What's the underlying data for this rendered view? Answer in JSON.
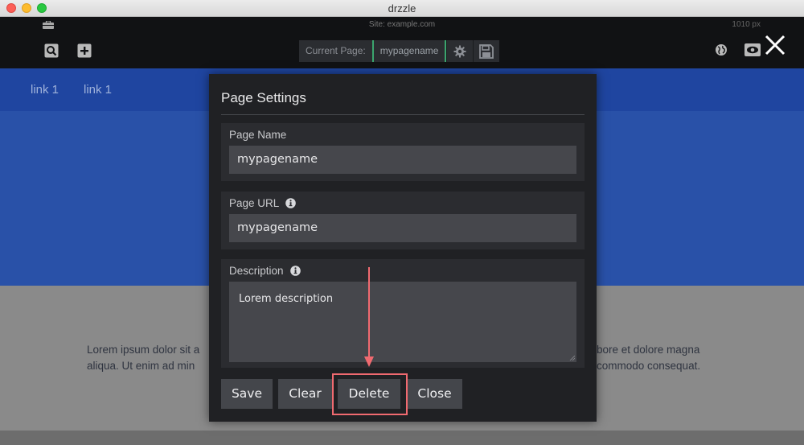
{
  "window": {
    "title": "drzzle"
  },
  "topbar": {
    "site_label": "Site: example.com",
    "width_label": "1010 px",
    "current_page_label": "Current Page:",
    "current_page_name": "mypagename",
    "icons": [
      "briefcase-icon",
      "preview-page-icon",
      "add-page-icon",
      "settings-icon",
      "save-icon",
      "globe-icon",
      "eye-icon",
      "close-icon"
    ]
  },
  "preview": {
    "nav_links": [
      "link 1",
      "link 1"
    ],
    "lorem_left_1": "Lorem ipsum dolor sit a",
    "lorem_left_2": "aliqua. Ut enim ad min",
    "lorem_right_1": "bore et dolore magna",
    "lorem_right_2": "commodo consequat."
  },
  "modal": {
    "title": "Page Settings",
    "fields": [
      {
        "label": "Page Name",
        "value": "mypagename",
        "has_info": false
      },
      {
        "label": "Page URL",
        "value": "mypagename",
        "has_info": true
      },
      {
        "label": "Description",
        "value": "Lorem description",
        "has_info": true
      }
    ],
    "buttons": {
      "save": "Save",
      "clear": "Clear",
      "delete": "Delete",
      "close": "Close"
    }
  },
  "colors": {
    "annotation": "#f06a70",
    "accent_green": "#3ba56e",
    "hero_blue": "#2951a8"
  }
}
